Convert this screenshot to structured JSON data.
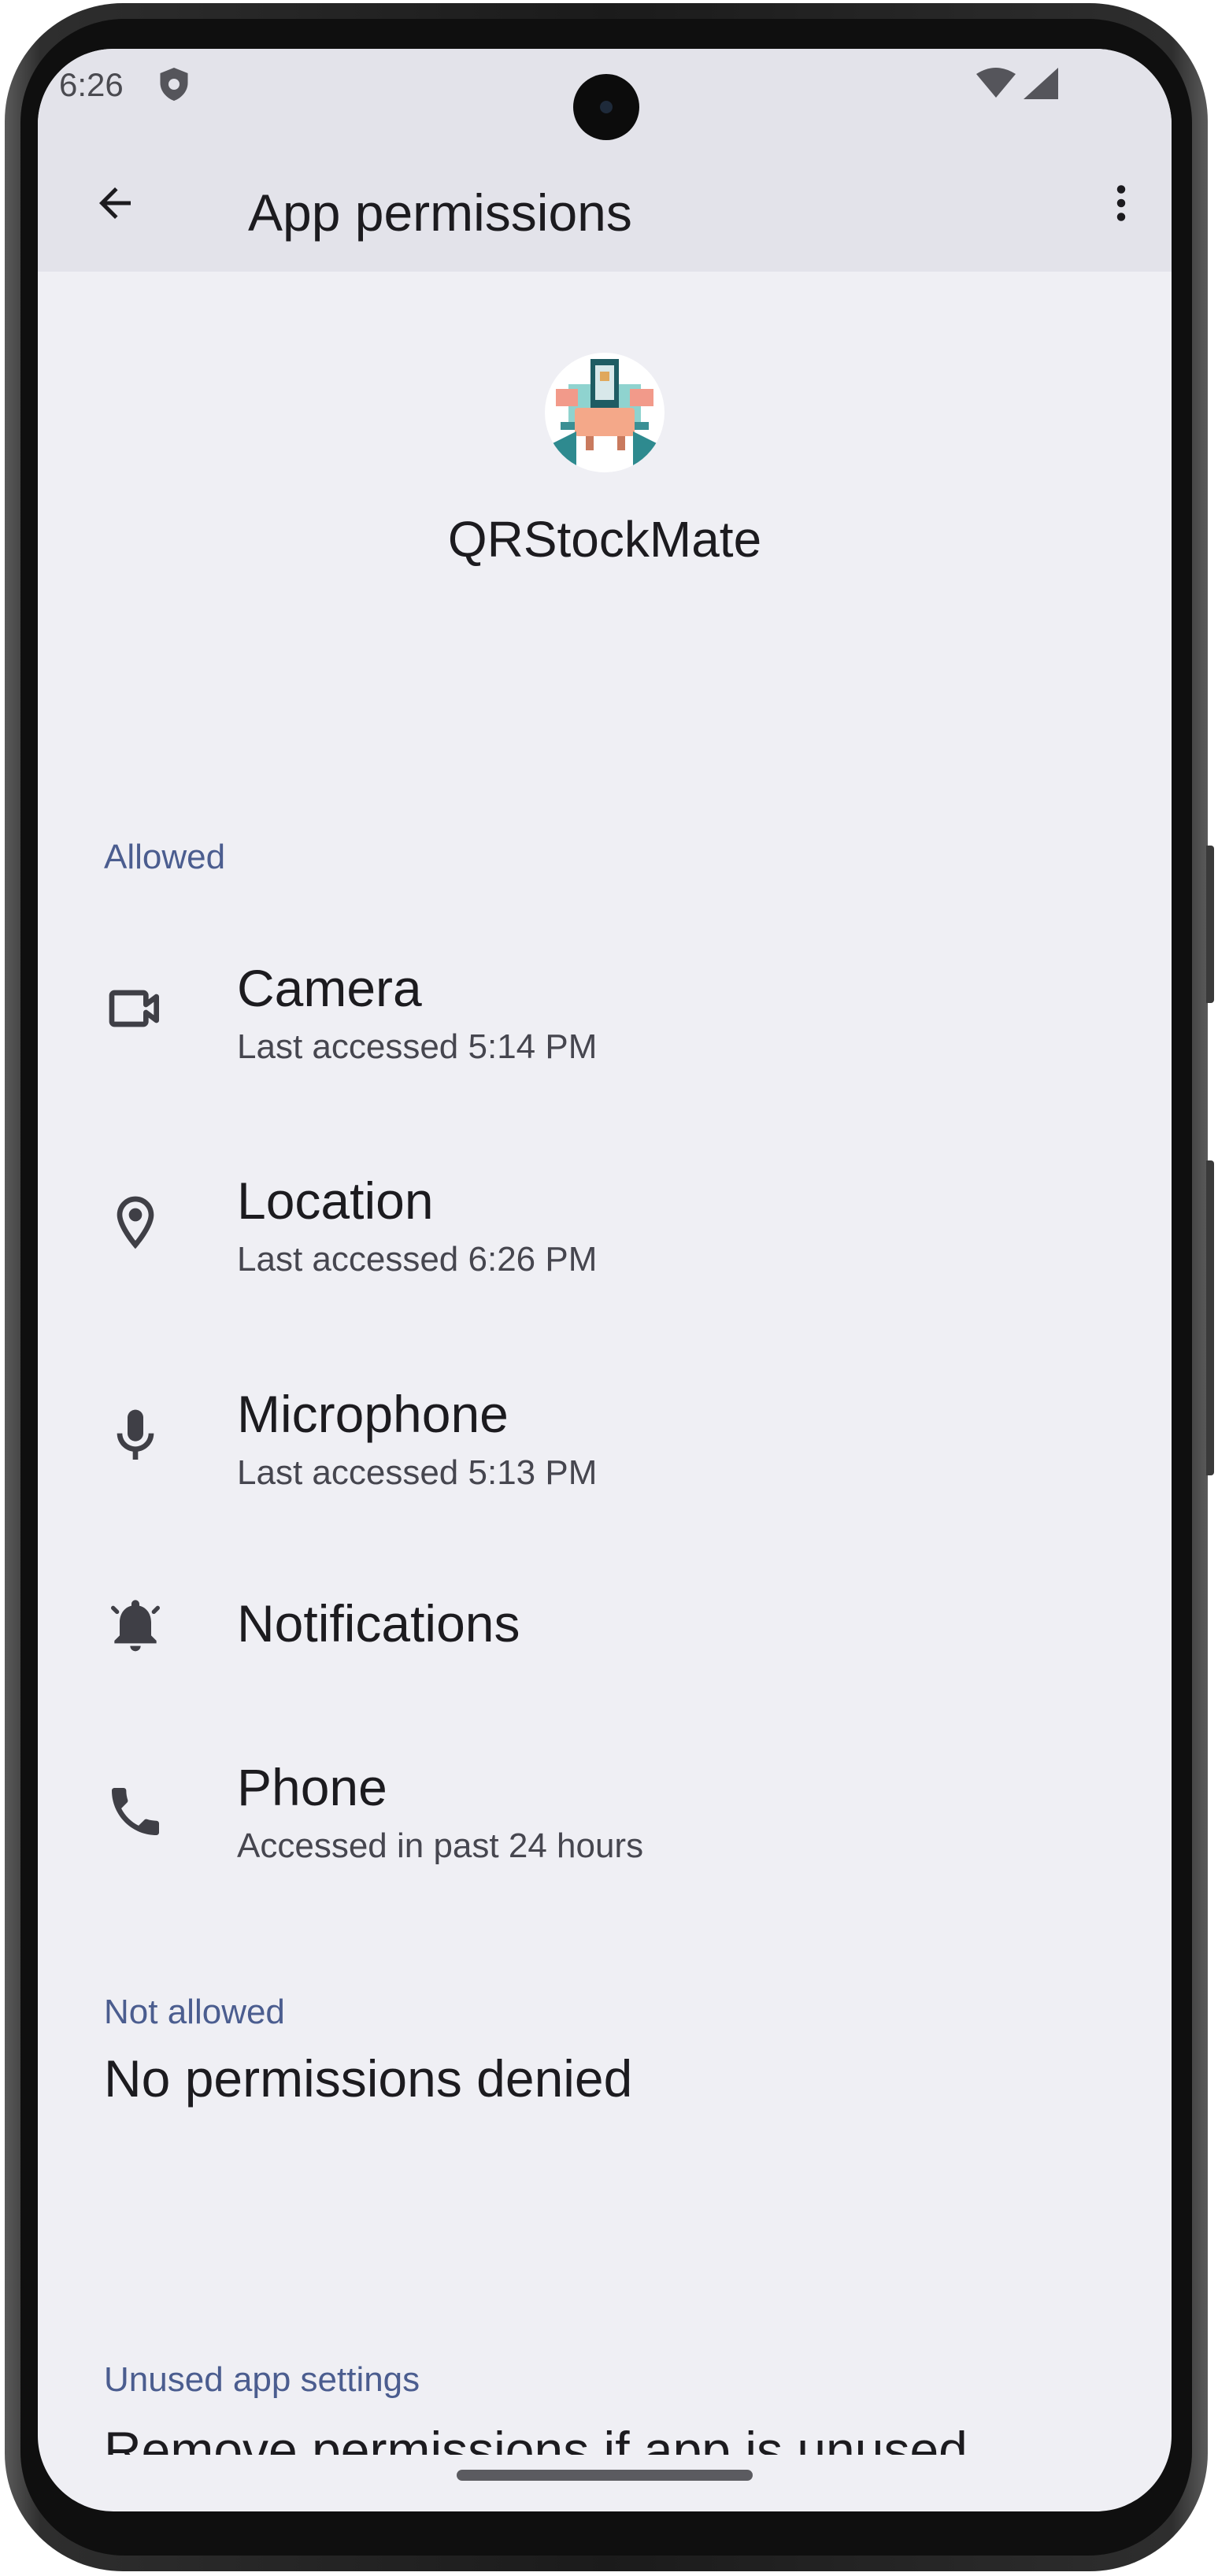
{
  "status_bar": {
    "time": "6:26",
    "shield_icon": "shield-icon",
    "wifi_icon": "wifi-icon",
    "signal_icon": "signal-icon"
  },
  "app_bar": {
    "back_icon": "arrow-back-icon",
    "title": "App permissions",
    "more_icon": "more-vert-icon"
  },
  "app": {
    "icon": "app-icon",
    "name": "QRStockMate"
  },
  "sections": {
    "allowed": {
      "header": "Allowed",
      "items": [
        {
          "icon": "videocam-icon",
          "title": "Camera",
          "subtitle": "Last accessed 5:14 PM"
        },
        {
          "icon": "location-pin-icon",
          "title": "Location",
          "subtitle": "Last accessed 6:26 PM"
        },
        {
          "icon": "microphone-icon",
          "title": "Microphone",
          "subtitle": "Last accessed 5:13 PM"
        },
        {
          "icon": "bell-icon",
          "title": "Notifications",
          "subtitle": ""
        },
        {
          "icon": "phone-icon",
          "title": "Phone",
          "subtitle": "Accessed in past 24 hours"
        }
      ]
    },
    "not_allowed": {
      "header": "Not allowed",
      "empty_text": "No permissions denied"
    },
    "unused": {
      "header": "Unused app settings",
      "partial_item": "Remove permissions if app is unused"
    }
  },
  "colors": {
    "background": "#efeff4",
    "app_bar": "#e3e3ea",
    "section_header": "#4b5d8f",
    "text_primary": "#1c1b1f",
    "text_secondary": "#46464f"
  }
}
